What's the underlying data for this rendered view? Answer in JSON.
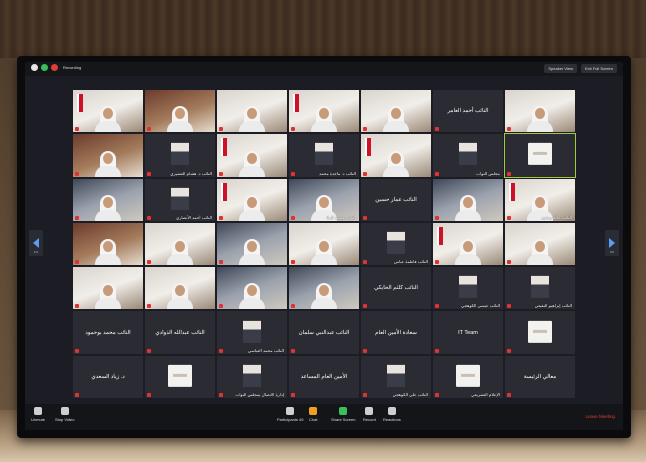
{
  "topbar": {
    "recording_label": "Recording",
    "speaker_view_label": "Speaker View",
    "exit_full_screen_label": "Exit Full Screen"
  },
  "tiles": [
    {
      "type": "video",
      "variant": "v2",
      "name": "",
      "flag": true
    },
    {
      "type": "video",
      "variant": "v3",
      "name": "",
      "flag": false
    },
    {
      "type": "video",
      "variant": "v2",
      "name": "",
      "flag": false
    },
    {
      "type": "video",
      "variant": "v2",
      "name": "",
      "flag": true
    },
    {
      "type": "video",
      "variant": "v2",
      "name": "",
      "flag": false
    },
    {
      "type": "text",
      "name": "النائب أحمد العامر"
    },
    {
      "type": "video",
      "variant": "v2",
      "name": "",
      "flag": false
    },
    {
      "type": "video",
      "variant": "v3",
      "name": "",
      "flag": false
    },
    {
      "type": "photo",
      "name": "النائب د. هشام العشيري"
    },
    {
      "type": "video",
      "variant": "v2",
      "name": "",
      "flag": true
    },
    {
      "type": "photo",
      "name": "النائب د. ماجدة محمد"
    },
    {
      "type": "video",
      "variant": "v2",
      "name": "",
      "flag": true
    },
    {
      "type": "photo",
      "name": "مجلس النواب"
    },
    {
      "type": "logo",
      "name": "",
      "active": true
    },
    {
      "type": "video",
      "variant": "v4",
      "name": "",
      "flag": false
    },
    {
      "type": "photo",
      "name": "النائب أحمد الأنصاري"
    },
    {
      "type": "video",
      "variant": "v2",
      "name": "",
      "flag": true
    },
    {
      "type": "video",
      "variant": "v4",
      "name": "النائب محمد الملا",
      "flag": false
    },
    {
      "type": "text",
      "name": "النائب عمار حسين"
    },
    {
      "type": "video",
      "variant": "v4",
      "name": "",
      "flag": false
    },
    {
      "type": "video",
      "variant": "v2",
      "name": "النائب خالد بوعنق",
      "flag": true
    },
    {
      "type": "video",
      "variant": "v3",
      "name": "",
      "flag": false
    },
    {
      "type": "video",
      "variant": "v2",
      "name": "",
      "flag": false
    },
    {
      "type": "video",
      "variant": "v4",
      "name": "",
      "flag": false
    },
    {
      "type": "video",
      "variant": "v2",
      "name": "",
      "flag": false
    },
    {
      "type": "photo",
      "name": "النائب فاطمة عباس"
    },
    {
      "type": "video",
      "variant": "v2",
      "name": "",
      "flag": true
    },
    {
      "type": "video",
      "variant": "v2",
      "name": "",
      "flag": false
    },
    {
      "type": "video",
      "variant": "v2",
      "name": "",
      "flag": false
    },
    {
      "type": "video",
      "variant": "v2",
      "name": "",
      "flag": false
    },
    {
      "type": "video",
      "variant": "v4",
      "name": "",
      "flag": false
    },
    {
      "type": "video",
      "variant": "v4",
      "name": "",
      "flag": false
    },
    {
      "type": "text",
      "name": "النائب كلثم الحايكي"
    },
    {
      "type": "photo",
      "name": "النائب عيسى الكوهجي"
    },
    {
      "type": "photo",
      "name": "النائب إبراهيم النفيعي"
    },
    {
      "type": "text",
      "name": "النائب محمد بوحمود"
    },
    {
      "type": "text",
      "name": "النائب عبدالله الذوادي"
    },
    {
      "type": "photo",
      "name": "النائب محمد العباسي"
    },
    {
      "type": "text",
      "name": "النائب عبدالنبي سلمان"
    },
    {
      "type": "text",
      "name": "سعادة الأمين العام"
    },
    {
      "type": "text",
      "name": "IT Team"
    },
    {
      "type": "logo",
      "name": ""
    },
    {
      "type": "text",
      "name": "د. زياد السعدي"
    },
    {
      "type": "logo",
      "name": ""
    },
    {
      "type": "photo",
      "name": "إدارة الاتصال بمجلس النواب"
    },
    {
      "type": "text",
      "name": "الأمين العام المساعد"
    },
    {
      "type": "photo",
      "name": "النائب علي الكوهجي"
    },
    {
      "type": "logo",
      "name": "الإعلام التشريعي"
    },
    {
      "type": "text",
      "name": "معالي الرئيسة"
    }
  ],
  "pager": {
    "left": "1/2",
    "right": "2/2"
  },
  "toolbar": {
    "unmute": "Unmute",
    "stop_video": "Stop Video",
    "participants": "Participants",
    "participants_count": "49",
    "chat": "Chat",
    "share_screen": "Share Screen",
    "record": "Record",
    "reactions": "Reactions",
    "leave": "Leave Meeting"
  },
  "colors": {
    "accent": "#5b9cf5",
    "active_speaker": "#9ecc3b",
    "leave": "#e23b3b",
    "share": "#3bbf5b"
  }
}
